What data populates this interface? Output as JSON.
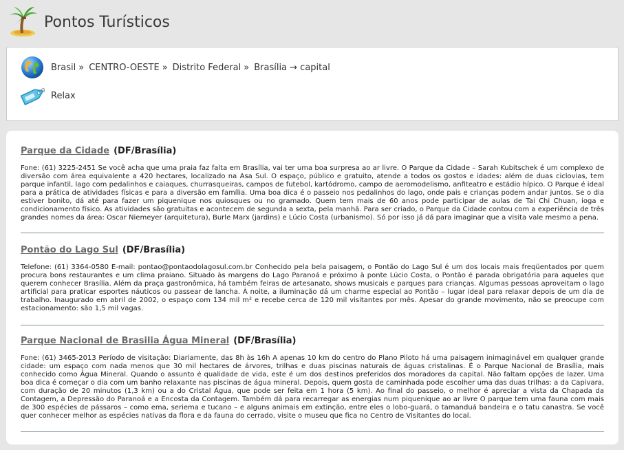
{
  "header": {
    "title": "Pontos Turísticos",
    "logo_icon": "palm-tree-island-icon"
  },
  "breadcrumb": {
    "icon": "globe-icon",
    "items": [
      "Brasil",
      "CENTRO-OESTE",
      "Distrito Federal",
      "Brasília → capital"
    ],
    "separator": "»"
  },
  "tag": {
    "icon": "tag-icon",
    "label": "Relax"
  },
  "entries": [
    {
      "name": "Parque da Cidade",
      "location": "(DF/Brasília)",
      "text": "Fone: (61) 3225-2451 Se você acha que uma praia faz falta em Brasília, vai ter uma boa surpresa ao ar livre. O Parque da Cidade – Sarah Kubitschek é um complexo de diversão com área equivalente a 420 hectares, localizado na Asa Sul. O espaço, público e gratuito, atende a todos os gostos e idades: além de duas ciclovias, tem parque infantil, lago com pedalinhos e caiaques, churrasqueiras, campos de futebol, kartódromo, campo de aeromodelismo, anfiteatro e estádio hípico. O Parque é ideal para a prática de atividades físicas e para a diversão em família. Uma boa dica é o passeio nos pedalinhos do lago, onde pais e crianças podem andar juntos. Se o dia estiver bonito, dá até para fazer um piquenique nos quiosques ou no gramado. Quem tem mais de 60 anos pode participar de aulas de Tai Chi Chuan, ioga e condicionamento físico. As atividades são gratuitas e acontecem de segunda a sexta, pela manhã. Para ser criado, o Parque da Cidade contou com a experiência de três grandes nomes da área: Oscar Niemeyer (arquitetura), Burle Marx (jardins) e Lúcio Costa (urbanismo). Só por isso já dá para imaginar que a visita vale mesmo a pena."
    },
    {
      "name": "Pontão do Lago Sul",
      "location": "(DF/Brasília)",
      "text": "Telefone: (61) 3364-0580 E-mail: pontao@pontaodolagosul.com.br Conhecido pela bela paisagem, o Pontão do Lago Sul é um dos locais mais freqüentados por quem procura bons restaurantes e um clima praiano. Situado às margens do Lago Paranoá e próximo à ponte Lúcio Costa, o Pontão é parada obrigatória para aqueles que querem conhecer Brasília. Além da praça gastronômica, há também feiras de artesanato, shows musicais e parques para crianças. Algumas pessoas aproveitam o lago artificial para praticar esportes náuticos ou passear de lancha. À noite, a iluminação dá um charme especial ao Pontão – lugar ideal para relaxar depois de um dia de trabalho. Inaugurado em abril de 2002, o espaço com 134 mil m² e recebe cerca de 120 mil visitantes por mês. Apesar do grande movimento, não se preocupe com estacionamento: são 1,5 mil vagas."
    },
    {
      "name": "Parque Nacional de Brasilia Água Mineral",
      "location": "(DF/Brasília)",
      "text": "Fone: (61) 3465-2013 Período de visitação: Diariamente, das 8h às 16h A apenas 10 km do centro do Plano Piloto há uma paisagem inimaginável em qualquer grande cidade: um espaço com nada menos que 30 mil hectares de árvores, trilhas e duas piscinas naturais de águas cristalinas. É o Parque Nacional de Brasília, mais conhecido como Água Mineral. Quando o assunto é qualidade de vida, este é um dos destinos preferidos dos moradores da capital. Não faltam opções de lazer. Uma boa dica é começar o dia com um banho relaxante nas piscinas de água mineral. Depois, quem gosta de caminhada pode escolher uma das duas trilhas: a da Capivara, com duração de 20 minutos (1,3 km) ou a do Cristal Água, que pode ser feita em 1 hora (5 km). Ao final do passeio, o melhor é apreciar a vista da Chapada da Contagem, a Depressão do Paranoá e a Encosta da Contagem. Também dá para recarregar as energias num piquenique ao ar livre O parque tem uma fauna com mais de 300 espécies de pássaros – como ema, seriema e tucano – e alguns animais em extinção, entre eles o lobo-guará, o tamanduá bandeira e o tatu canastra. Se você quer conhecer melhor as espécies nativas da flora e da fauna do cerrado, visite o museu que fica no Centro de Visitantes do local."
    }
  ]
}
